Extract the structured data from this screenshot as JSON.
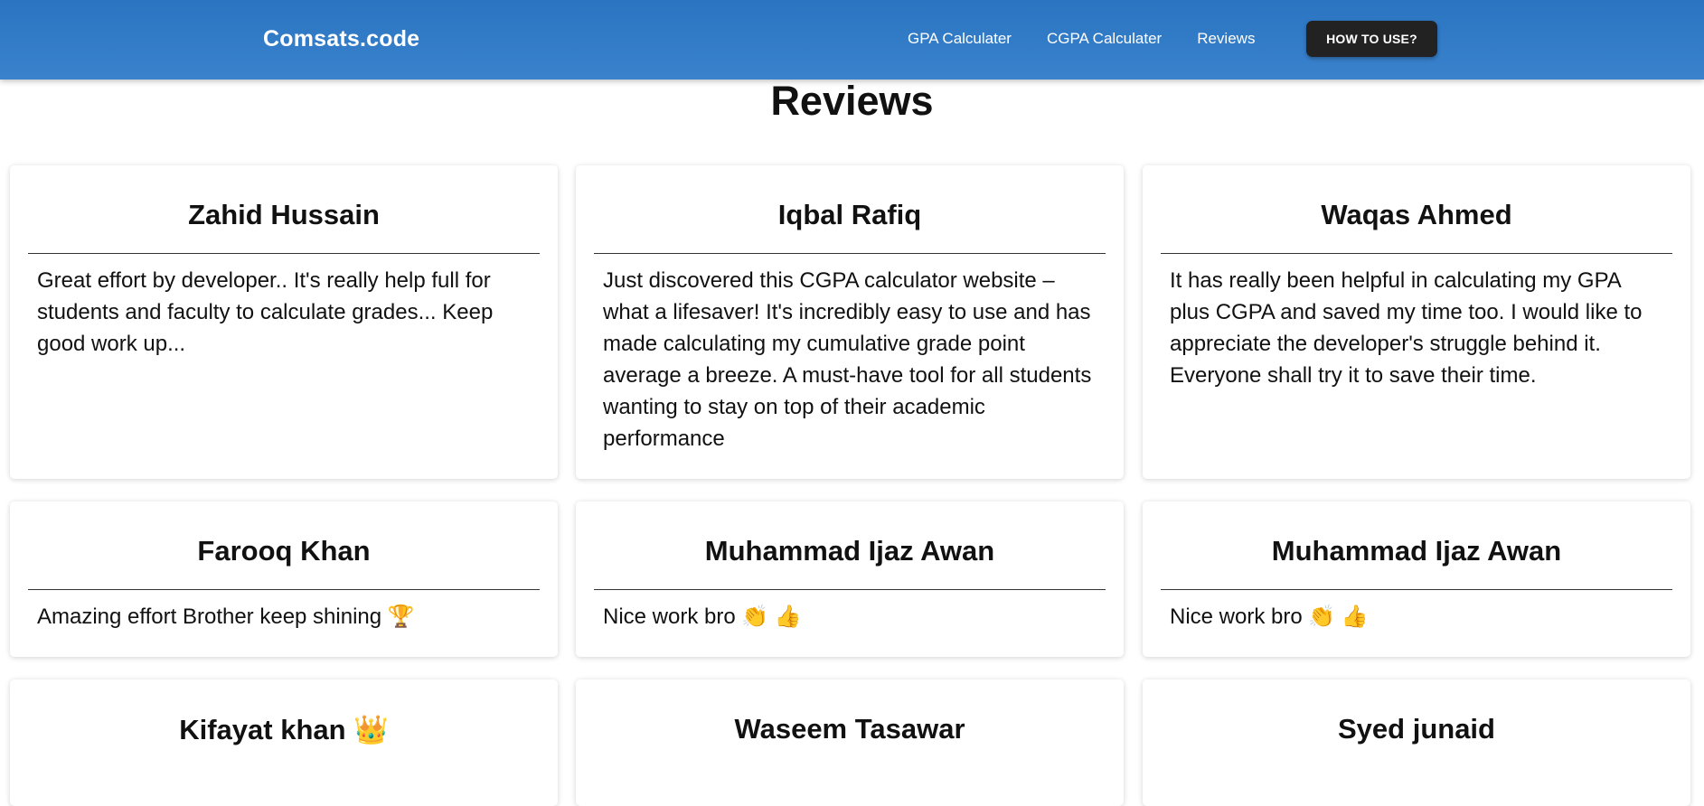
{
  "nav": {
    "brand": "Comsats.code",
    "links": [
      "GPA Calculater",
      "CGPA Calculater",
      "Reviews"
    ],
    "cta": "HOW TO USE?"
  },
  "page": {
    "title": "Reviews"
  },
  "reviews": [
    {
      "name": "Zahid Hussain",
      "text": "Great effort by developer.. It's really help full for students and faculty to calculate grades... Keep good work up..."
    },
    {
      "name": "Iqbal Rafiq",
      "text": "Just discovered this CGPA calculator website – what a lifesaver! It's incredibly easy to use and has made calculating my cumulative grade point average a breeze. A must-have tool for all students wanting to stay on top of their academic performance"
    },
    {
      "name": "Waqas Ahmed",
      "text": "It has really been helpful in calculating my GPA plus CGPA and saved my time too. I would like to appreciate the developer's struggle behind it. Everyone shall try it to save their time."
    },
    {
      "name": "Farooq Khan",
      "text": "Amazing effort Brother keep shining 🏆"
    },
    {
      "name": "Muhammad Ijaz Awan",
      "text": "Nice work bro 👏 👍"
    },
    {
      "name": "Muhammad Ijaz Awan",
      "text": "Nice work bro 👏 👍"
    },
    {
      "name": "Kifayat khan 👑",
      "text": ""
    },
    {
      "name": "Waseem Tasawar",
      "text": ""
    },
    {
      "name": "Syed junaid",
      "text": ""
    }
  ]
}
